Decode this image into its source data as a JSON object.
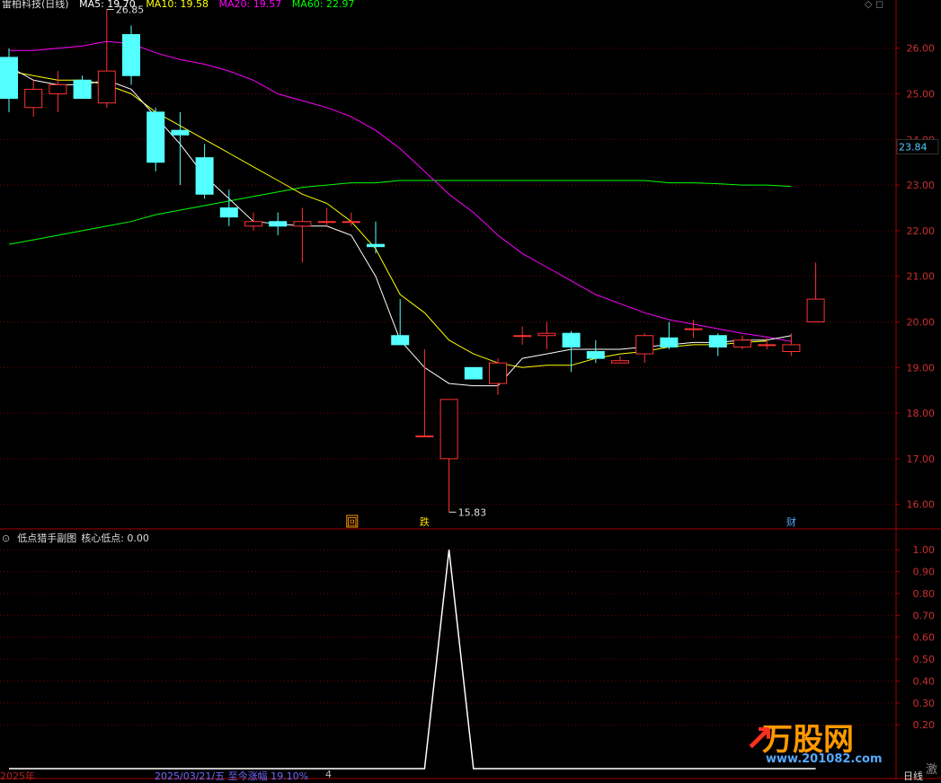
{
  "header": {
    "stock": "雷柏科技(日线)",
    "ma5": "MA5: 19.70",
    "ma10": "MA10: 19.58",
    "ma20": "MA20: 19.57",
    "ma60": "MA60: 22.97"
  },
  "sub_header": {
    "title": "低点猎手副图",
    "value": "核心低点: 0.00"
  },
  "price_tag": "23.84",
  "markers": {
    "hi": "26.85",
    "lo": "15.83",
    "m1": "回",
    "m2": "跌",
    "m3": "财"
  },
  "footer": {
    "year": "2025年",
    "info": "2025/03/21/五  至今涨幅 19.10%",
    "num": "4",
    "period": "日线",
    "vibe": "激"
  },
  "watermark": {
    "brand": "万股网",
    "site": "www.201082.com"
  },
  "colors": {
    "up": "#ff3232",
    "down": "#54ffff",
    "ma5": "#ffffff",
    "ma10": "#ffff00",
    "ma20": "#ff00ff",
    "ma60": "#00ff00",
    "grid": "#7a0000"
  },
  "chart_data": [
    {
      "type": "candlestick",
      "ylim": [
        15.6,
        26.9
      ],
      "yticks": [
        "26.00",
        "25.00",
        "24.00",
        "23.00",
        "22.00",
        "21.00",
        "20.00",
        "19.00",
        "18.00",
        "17.00",
        "16.00"
      ],
      "candles": [
        {
          "o": 25.8,
          "c": 24.9,
          "h": 26.0,
          "l": 24.6
        },
        {
          "o": 24.7,
          "c": 25.1,
          "h": 25.3,
          "l": 24.5
        },
        {
          "o": 25.0,
          "c": 25.2,
          "h": 25.5,
          "l": 24.6
        },
        {
          "o": 25.3,
          "c": 24.9,
          "h": 25.4,
          "l": 24.9
        },
        {
          "o": 24.8,
          "c": 25.5,
          "h": 26.85,
          "l": 24.7
        },
        {
          "o": 26.3,
          "c": 25.4,
          "h": 26.5,
          "l": 25.2
        },
        {
          "o": 24.6,
          "c": 23.5,
          "h": 24.7,
          "l": 23.3
        },
        {
          "o": 24.2,
          "c": 24.1,
          "h": 24.6,
          "l": 23.0
        },
        {
          "o": 23.6,
          "c": 22.8,
          "h": 23.9,
          "l": 22.7
        },
        {
          "o": 22.5,
          "c": 22.3,
          "h": 22.9,
          "l": 22.1
        },
        {
          "o": 22.1,
          "c": 22.2,
          "h": 22.4,
          "l": 22.0
        },
        {
          "o": 22.2,
          "c": 22.1,
          "h": 22.4,
          "l": 21.9
        },
        {
          "o": 22.1,
          "c": 22.2,
          "h": 22.5,
          "l": 21.3
        },
        {
          "o": 22.2,
          "c": 22.2,
          "h": 22.5,
          "l": 22.1
        },
        {
          "o": 22.2,
          "c": 22.2,
          "h": 22.4,
          "l": 22.1
        },
        {
          "o": 21.7,
          "c": 21.65,
          "h": 22.2,
          "l": 21.5
        },
        {
          "o": 19.7,
          "c": 19.5,
          "h": 20.5,
          "l": 19.5
        },
        {
          "o": 17.5,
          "c": 17.5,
          "h": 19.4,
          "l": 17.5
        },
        {
          "o": 17.0,
          "c": 18.3,
          "h": 18.3,
          "l": 15.83
        },
        {
          "o": 19.0,
          "c": 18.75,
          "h": 19.0,
          "l": 18.75
        },
        {
          "o": 18.65,
          "c": 19.1,
          "h": 19.2,
          "l": 18.4
        },
        {
          "o": 19.7,
          "c": 19.7,
          "h": 19.9,
          "l": 19.5
        },
        {
          "o": 19.7,
          "c": 19.75,
          "h": 20.0,
          "l": 19.4
        },
        {
          "o": 19.75,
          "c": 19.45,
          "h": 19.8,
          "l": 18.9
        },
        {
          "o": 19.35,
          "c": 19.2,
          "h": 19.6,
          "l": 19.1
        },
        {
          "o": 19.1,
          "c": 19.15,
          "h": 19.25,
          "l": 19.1
        },
        {
          "o": 19.3,
          "c": 19.7,
          "h": 19.75,
          "l": 19.1
        },
        {
          "o": 19.65,
          "c": 19.45,
          "h": 20.0,
          "l": 19.4
        },
        {
          "o": 19.85,
          "c": 19.85,
          "h": 20.05,
          "l": 19.65
        },
        {
          "o": 19.7,
          "c": 19.45,
          "h": 19.75,
          "l": 19.25
        },
        {
          "o": 19.45,
          "c": 19.6,
          "h": 19.7,
          "l": 19.4
        },
        {
          "o": 19.5,
          "c": 19.5,
          "h": 19.65,
          "l": 19.4
        },
        {
          "o": 19.35,
          "c": 19.5,
          "h": 19.75,
          "l": 19.25
        },
        {
          "o": 20.0,
          "c": 20.5,
          "h": 21.3,
          "l": 20.0
        }
      ],
      "ma5": [
        25.6,
        25.3,
        25.2,
        25.2,
        25.3,
        25.1,
        24.5,
        23.9,
        23.2,
        22.7,
        22.2,
        22.15,
        22.1,
        22.1,
        21.9,
        21.0,
        19.6,
        19.0,
        18.65,
        18.6,
        18.6,
        19.2,
        19.3,
        19.4,
        19.4,
        19.4,
        19.45,
        19.5,
        19.55,
        19.55,
        19.6,
        19.6,
        19.7
      ],
      "ma10": [
        25.5,
        25.4,
        25.3,
        25.3,
        25.2,
        25.0,
        24.6,
        24.3,
        24.0,
        23.7,
        23.4,
        23.1,
        22.8,
        22.6,
        22.2,
        21.6,
        20.6,
        20.2,
        19.6,
        19.3,
        19.1,
        19.0,
        19.05,
        19.05,
        19.2,
        19.3,
        19.35,
        19.45,
        19.5,
        19.5,
        19.55,
        19.58
      ],
      "ma20": [
        25.95,
        25.95,
        26.0,
        26.05,
        26.15,
        26.1,
        25.9,
        25.75,
        25.65,
        25.5,
        25.3,
        25.0,
        24.85,
        24.7,
        24.5,
        24.2,
        23.8,
        23.3,
        22.8,
        22.4,
        21.9,
        21.5,
        21.2,
        20.9,
        20.6,
        20.4,
        20.2,
        20.05,
        19.95,
        19.85,
        19.75,
        19.67,
        19.57
      ],
      "ma60": [
        21.7,
        21.8,
        21.9,
        22.0,
        22.1,
        22.2,
        22.35,
        22.45,
        22.55,
        22.65,
        22.75,
        22.85,
        22.95,
        23.0,
        23.05,
        23.05,
        23.1,
        23.1,
        23.1,
        23.1,
        23.1,
        23.1,
        23.1,
        23.1,
        23.1,
        23.1,
        23.1,
        23.05,
        23.05,
        23.03,
        23.0,
        23.0,
        22.97
      ]
    },
    {
      "type": "line",
      "ylim": [
        0,
        1.05
      ],
      "yticks": [
        "1.00",
        "0.90",
        "0.80",
        "0.70",
        "0.60",
        "0.50",
        "0.40",
        "0.30",
        "0.20"
      ],
      "x_index": [
        0,
        17,
        18,
        19,
        33
      ],
      "values": [
        0,
        0,
        1,
        0,
        0
      ]
    }
  ]
}
